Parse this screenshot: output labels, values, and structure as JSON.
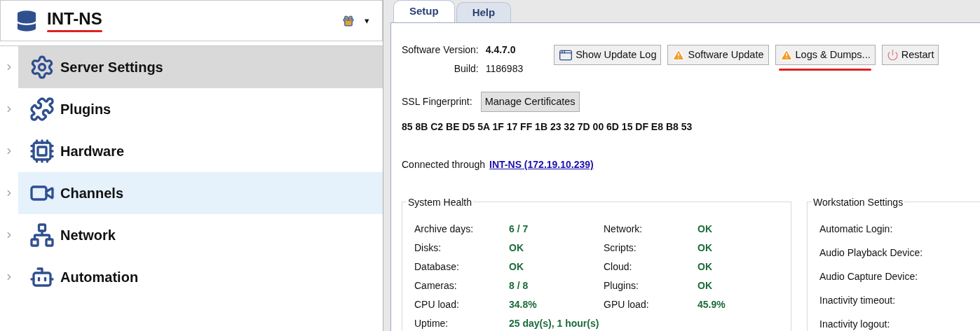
{
  "server": {
    "name": "INT-NS",
    "underlined": true,
    "menu_caret": "▾"
  },
  "sidebar": {
    "items": [
      {
        "label": "Server Settings",
        "kind": "gear",
        "selected": true,
        "hovered": false
      },
      {
        "label": "Plugins",
        "kind": "puzzle",
        "selected": false,
        "hovered": false
      },
      {
        "label": "Hardware",
        "kind": "chip",
        "selected": false,
        "hovered": false
      },
      {
        "label": "Channels",
        "kind": "camera",
        "selected": false,
        "hovered": true
      },
      {
        "label": "Network",
        "kind": "network",
        "selected": false,
        "hovered": false
      },
      {
        "label": "Automation",
        "kind": "robot",
        "selected": false,
        "hovered": false
      }
    ]
  },
  "tabs": [
    {
      "label": "Setup",
      "selected": true
    },
    {
      "label": "Help",
      "selected": false
    }
  ],
  "version": {
    "software_label": "Software Version:",
    "software_value": "4.4.7.0",
    "build_label": "Build:",
    "build_value": "1186983"
  },
  "buttons": [
    {
      "label": "Show Update Log",
      "kind": "window",
      "underlined": false
    },
    {
      "label": "Software Update",
      "kind": "warning",
      "underlined": false
    },
    {
      "label": "Logs & Dumps...",
      "kind": "warning",
      "underlined": true
    },
    {
      "label": "Restart",
      "kind": "power",
      "underlined": false
    }
  ],
  "ssl": {
    "label": "SSL Fingerprint:",
    "button": "Manage Certificates",
    "fingerprint": "85 8B C2 BE D5 5A 1F 17 FF 1B 23 32 7D 00 6D 15 DF E8 B8 53"
  },
  "connection": {
    "label": "Connected through",
    "link": "INT-NS (172.19.10.239)"
  },
  "system_health": {
    "title": "System Health",
    "rows": [
      [
        {
          "label": "Archive days:",
          "value": "6 / 7"
        },
        {
          "label": "Network:",
          "value": "OK"
        }
      ],
      [
        {
          "label": "Disks:",
          "value": "OK"
        },
        {
          "label": "Scripts:",
          "value": "OK"
        }
      ],
      [
        {
          "label": "Database:",
          "value": "OK"
        },
        {
          "label": "Cloud:",
          "value": "OK"
        }
      ],
      [
        {
          "label": "Cameras:",
          "value": "8 / 8"
        },
        {
          "label": "Plugins:",
          "value": "OK"
        }
      ],
      [
        {
          "label": "CPU load:",
          "value": "34.8%"
        },
        {
          "label": "GPU load:",
          "value": "45.9%"
        }
      ],
      [
        {
          "label": "Uptime:",
          "value": "25 day(s), 1 hour(s)"
        }
      ]
    ]
  },
  "workstation_settings": {
    "title": "Workstation Settings",
    "items": [
      "Automatic Login:",
      "Audio Playback Device:",
      "Audio Capture Device:",
      "Inactivity timeout:",
      "Inactivity logout:"
    ]
  }
}
